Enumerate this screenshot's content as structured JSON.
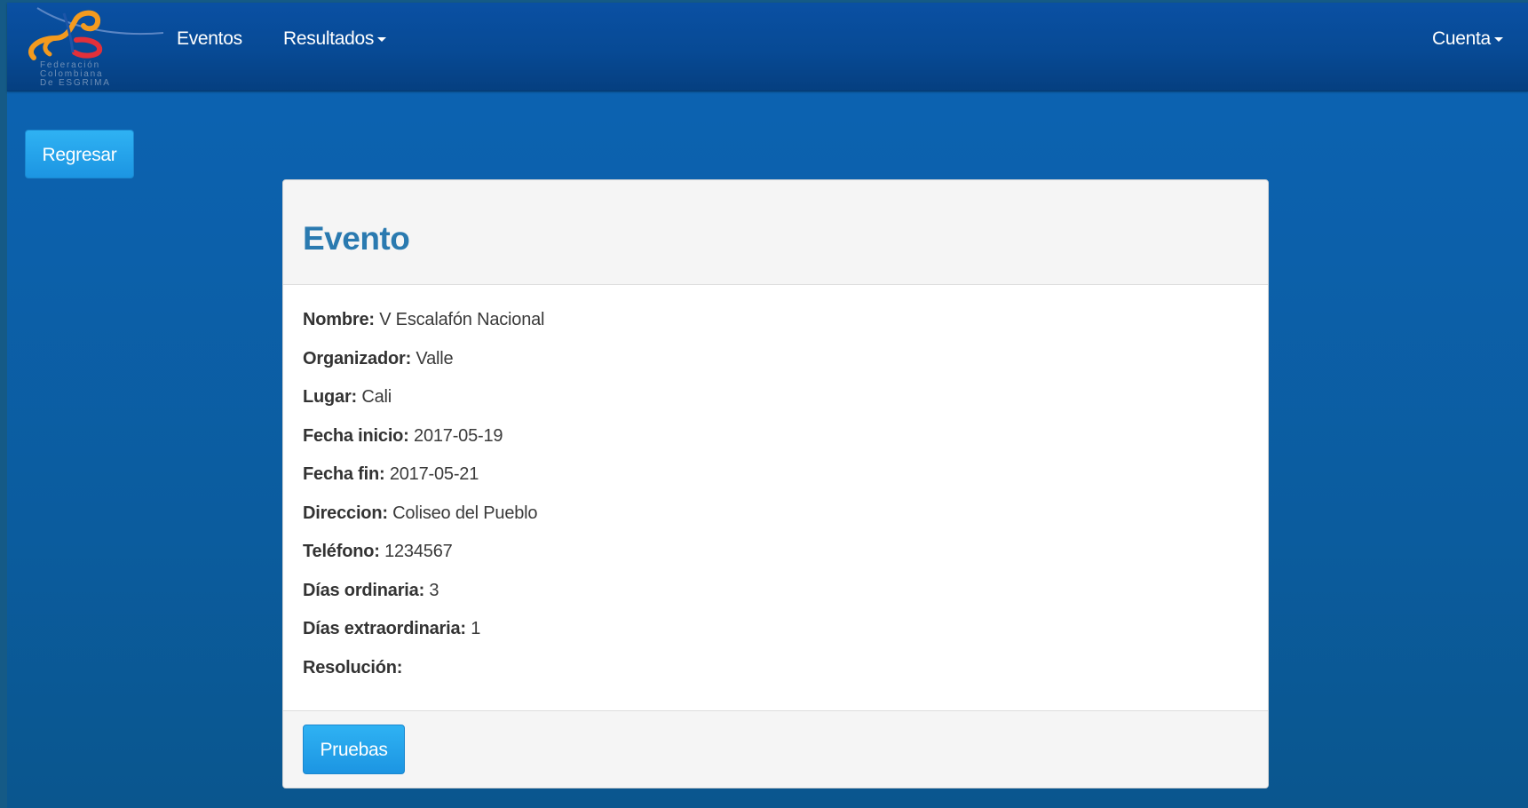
{
  "navbar": {
    "logo_text": "Federación\nColombiana\nDe ESGRIMA",
    "links": [
      {
        "label": "Eventos"
      },
      {
        "label": "Resultados"
      }
    ],
    "account_label": "Cuenta"
  },
  "back_button": "Regresar",
  "panel": {
    "title": "Evento",
    "fields": [
      {
        "label": "Nombre:",
        "value": "V Escalafón Nacional"
      },
      {
        "label": "Organizador:",
        "value": "Valle"
      },
      {
        "label": "Lugar:",
        "value": "Cali"
      },
      {
        "label": "Fecha inicio:",
        "value": "2017-05-19"
      },
      {
        "label": "Fecha fin:",
        "value": "2017-05-21"
      },
      {
        "label": "Direccion:",
        "value": "Coliseo del Pueblo"
      },
      {
        "label": "Teléfono:",
        "value": "1234567"
      },
      {
        "label": "Días ordinaria:",
        "value": "3"
      },
      {
        "label": "Días extraordinaria:",
        "value": "1"
      },
      {
        "label": "Resolución:",
        "value": ""
      }
    ],
    "footer_button": "Pruebas"
  },
  "colors": {
    "navbar": "#074a95",
    "background": "#0c62b0",
    "title": "#2a7ab0",
    "button": "#1c95e2",
    "logo_orange": "#f39a1e",
    "logo_red": "#e2303a"
  },
  "icons": {
    "logo": "fencing-federation-logo",
    "dropdown": "caret-down-icon"
  }
}
